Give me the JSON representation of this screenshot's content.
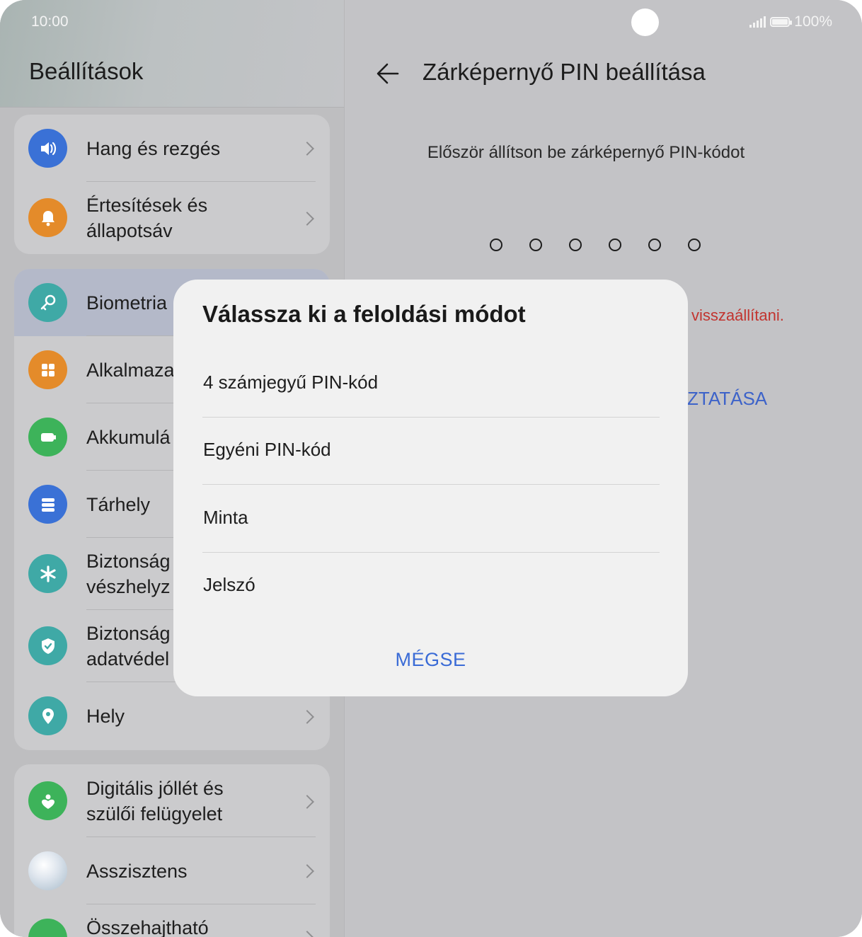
{
  "status_bar": {
    "time": "10:00",
    "battery_text": "100%"
  },
  "settings": {
    "title": "Beállítások",
    "groups": [
      {
        "items": [
          {
            "label": "Hang és rezgés",
            "icon": "speaker-icon",
            "color": "#3a71d6"
          },
          {
            "label": "Értesítések és állapotsáv",
            "line1": "Értesítések és",
            "line2": "állapotsáv",
            "icon": "bell-icon",
            "color": "#e48b2a"
          }
        ]
      },
      {
        "items": [
          {
            "label": "Biometria",
            "icon": "key-icon",
            "color": "#3fa9a6"
          },
          {
            "label": "Alkalmaza",
            "icon": "apps-icon",
            "color": "#e48b2a"
          },
          {
            "label": "Akkumulá",
            "icon": "battery-icon",
            "color": "#3db35a"
          },
          {
            "label": "Tárhely",
            "icon": "storage-icon",
            "color": "#3a71d6"
          },
          {
            "label": "Biztonság vészhelyz",
            "line1": "Biztonság",
            "line2": "vészhelyz",
            "icon": "asterisk-icon",
            "color": "#3fa9a6"
          },
          {
            "label": "Biztonság adatvéde",
            "line1": "Biztonság",
            "line2": "adatvédel",
            "icon": "shield-icon",
            "color": "#3fa9a6"
          },
          {
            "label": "Hely",
            "icon": "location-icon",
            "color": "#3fa9a6"
          }
        ]
      },
      {
        "items": [
          {
            "label": "Digitális jóllét és szülői felügyelet",
            "line1": "Digitális jóllét és",
            "line2": "szülői felügyelet",
            "icon": "heart-icon",
            "color": "#3db35a"
          },
          {
            "label": "Asszisztens",
            "icon": "assistant-icon",
            "color": "#c9d8e6"
          },
          {
            "label": "Összehajtható",
            "icon": "foldable-icon",
            "color": "#3db35a"
          }
        ]
      }
    ]
  },
  "pin_screen": {
    "title": "Zárképernyő PIN beállítása",
    "instruction": "Először állítson be zárképernyő PIN-kódot",
    "dot_count": 6,
    "reset_text": "visszaállítani.",
    "link_text": "ZTATÁSA"
  },
  "dialog": {
    "title": "Válassza ki a feloldási módot",
    "options": [
      "4 számjegyű PIN-kód",
      "Egyéni PIN-kód",
      "Minta",
      "Jelszó"
    ],
    "cancel_label": "MÉGSE"
  }
}
